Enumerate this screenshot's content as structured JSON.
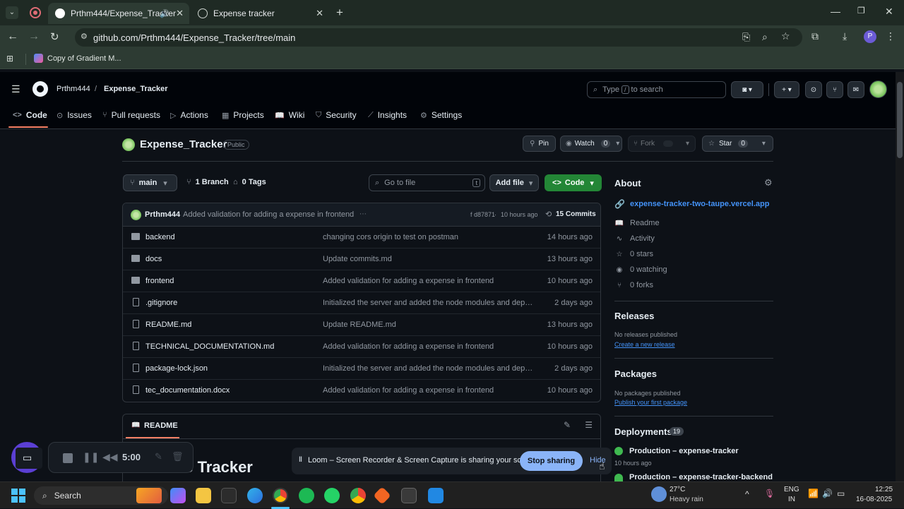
{
  "browser": {
    "tabs": [
      {
        "title": "Prthm444/Expense_Tracker",
        "active": true
      },
      {
        "title": "Expense tracker",
        "active": false
      }
    ],
    "url": "github.com/Prthm444/Expense_Tracker/tree/main",
    "bookmark": "Copy of Gradient M..."
  },
  "header": {
    "owner": "Prthm444",
    "separator": "/",
    "repo": "Expense_Tracker",
    "search_placeholder_pre": "Type",
    "search_key": "/",
    "search_placeholder_post": "to search"
  },
  "nav": [
    {
      "label": "Code",
      "icon": "code-icon"
    },
    {
      "label": "Issues",
      "icon": "issue-icon"
    },
    {
      "label": "Pull requests",
      "icon": "pull-request-icon"
    },
    {
      "label": "Actions",
      "icon": "play-icon"
    },
    {
      "label": "Projects",
      "icon": "table-icon"
    },
    {
      "label": "Wiki",
      "icon": "book-icon"
    },
    {
      "label": "Security",
      "icon": "shield-icon"
    },
    {
      "label": "Insights",
      "icon": "graph-icon"
    },
    {
      "label": "Settings",
      "icon": "gear-icon"
    }
  ],
  "repo": {
    "name": "Expense_Tracker",
    "visibility": "Public",
    "pin": "Pin",
    "watch": "Watch",
    "watch_count": "0",
    "fork": "Fork",
    "star": "Star",
    "star_count": "0"
  },
  "toolbar": {
    "branch": "main",
    "branches": "1 Branch",
    "tags": "0 Tags",
    "goto_placeholder": "Go to file",
    "goto_key": "t",
    "add_file": "Add file",
    "code": "Code"
  },
  "commit": {
    "author": "Prthm444",
    "message": "Added validation for adding a expense in frontend",
    "hash": "f d87871",
    "time": "10 hours ago",
    "count": "15 Commits"
  },
  "files": [
    {
      "name": "backend",
      "type": "folder",
      "message": "changing cors origin to test on postman",
      "date": "14 hours ago"
    },
    {
      "name": "docs",
      "type": "folder",
      "message": "Update commits.md",
      "date": "13 hours ago"
    },
    {
      "name": "frontend",
      "type": "folder",
      "message": "Added validation for adding a expense in frontend",
      "date": "10 hours ago"
    },
    {
      "name": ".gitignore",
      "type": "file",
      "message": "Initialized the server and added the node modules and depe...",
      "date": "2 days ago"
    },
    {
      "name": "README.md",
      "type": "file",
      "message": "Update README.md",
      "date": "13 hours ago"
    },
    {
      "name": "TECHNICAL_DOCUMENTATION.md",
      "type": "file",
      "message": "Added validation for adding a expense in frontend",
      "date": "10 hours ago"
    },
    {
      "name": "package-lock.json",
      "type": "file",
      "message": "Initialized the server and added the node modules and depe...",
      "date": "2 days ago"
    },
    {
      "name": "tec_documentation.docx",
      "type": "file",
      "message": "Added validation for adding a expense in frontend",
      "date": "10 hours ago"
    }
  ],
  "readme": {
    "tab": "README",
    "heading_fragment": "se Tracker"
  },
  "about": {
    "title": "About",
    "link": "expense-tracker-two-taupe.vercel.app",
    "readme": "Readme",
    "activity": "Activity",
    "stars": "0 stars",
    "watching": "0 watching",
    "forks": "0 forks"
  },
  "releases": {
    "title": "Releases",
    "none": "No releases published",
    "create": "Create a new release"
  },
  "packages": {
    "title": "Packages",
    "none": "No packages published",
    "publish": "Publish your first package"
  },
  "deployments": {
    "title": "Deployments",
    "count": "19",
    "items": [
      {
        "name": "Production – expense-tracker",
        "time": "10 hours ago"
      },
      {
        "name": "Production – expense-tracker-backend"
      }
    ]
  },
  "recorder": {
    "time": "5:00"
  },
  "loom": {
    "message": "Loom – Screen Recorder & Screen Capture is sharing your screen.",
    "stop": "Stop sharing",
    "hide": "Hide"
  },
  "taskbar": {
    "search": "Search",
    "weather_temp": "27°C",
    "weather_desc": "Heavy rain",
    "lang_1": "ENG",
    "lang_2": "IN",
    "time": "12:25",
    "date": "16-08-2025"
  },
  "colors": {
    "green": "#238636",
    "link": "#4493f8",
    "accent_underline": "#f78166"
  }
}
